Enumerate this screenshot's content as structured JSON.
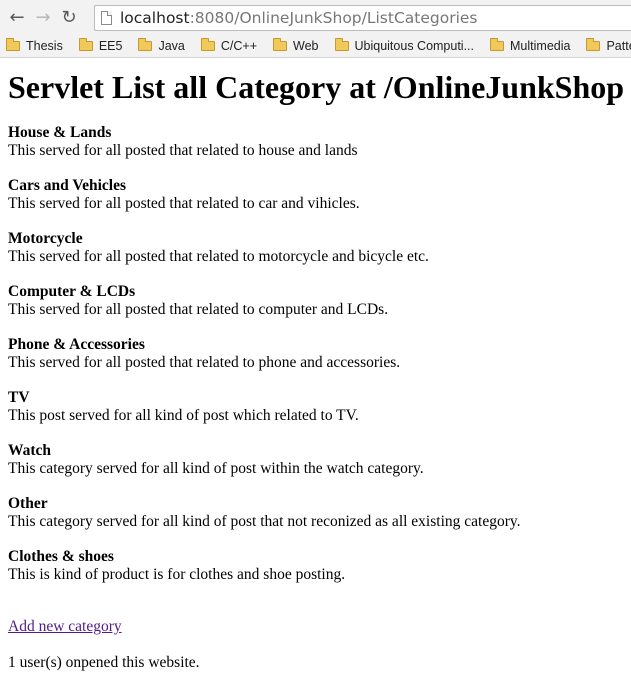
{
  "browser": {
    "url_host": "localhost",
    "url_path": ":8080/OnlineJunkShop/ListCategories",
    "bookmarks": [
      "Thesis",
      "EE5",
      "Java",
      "C/C++",
      "Web",
      "Ubiquitous Computi...",
      "Multimedia",
      "Patterns"
    ]
  },
  "page": {
    "title": "Servlet List all Category at /OnlineJunkShop",
    "categories": [
      {
        "name": "House & Lands",
        "description": "This served for all posted that related to house and lands"
      },
      {
        "name": "Cars and Vehicles",
        "description": "This served for all posted that related to car and vihicles."
      },
      {
        "name": "Motorcycle",
        "description": "This served for all posted that related to motorcycle and bicycle etc."
      },
      {
        "name": "Computer & LCDs",
        "description": "This served for all posted that related to computer and LCDs."
      },
      {
        "name": "Phone & Accessories",
        "description": "This served for all posted that related to phone and accessories."
      },
      {
        "name": "TV",
        "description": "This post served for all kind of post which related to TV."
      },
      {
        "name": "Watch",
        "description": "This category served for all kind of post within the watch category."
      },
      {
        "name": "Other",
        "description": "This category served for all kind of post that not reconized as all existing category."
      },
      {
        "name": "Clothes & shoes",
        "description": "This is kind of product is for clothes and shoe posting."
      }
    ],
    "add_link": "Add new category",
    "visitor_text": "1 user(s) onpened this website."
  }
}
